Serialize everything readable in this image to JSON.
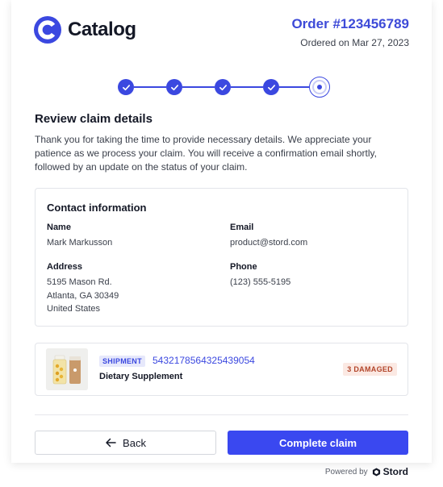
{
  "brand": {
    "name": "Catalog",
    "accent": "#3b48e0"
  },
  "order": {
    "number": "Order #123456789",
    "date": "Ordered on Mar 27, 2023"
  },
  "stepper": {
    "completed_steps": 4,
    "total_steps": 5
  },
  "review": {
    "title": "Review claim details",
    "intro": "Thank you for taking the time to provide necessary details. We appreciate your patience as we process your claim. You will receive a confirmation email shortly, followed by an update on the status of your claim."
  },
  "contact": {
    "title": "Contact information",
    "name_label": "Name",
    "name_value": "Mark Markusson",
    "email_label": "Email",
    "email_value": "product@stord.com",
    "address_label": "Address",
    "address_line1": "5195 Mason Rd.",
    "address_line2": "Atlanta, GA 30349",
    "address_line3": "United States",
    "phone_label": "Phone",
    "phone_value": "(123) 555-5195"
  },
  "shipment": {
    "badge": "SHIPMENT",
    "number": "5432178564325439054",
    "product": "Dietary Supplement",
    "status": "3 DAMAGED"
  },
  "actions": {
    "back_label": "Back",
    "complete_label": "Complete claim"
  },
  "footer": {
    "powered_by": "Powered by",
    "company": "Stord"
  },
  "colors": {
    "primary_button": "#3a48f0",
    "damaged_text": "#b2452a",
    "damaged_bg": "#fbe9e3"
  }
}
